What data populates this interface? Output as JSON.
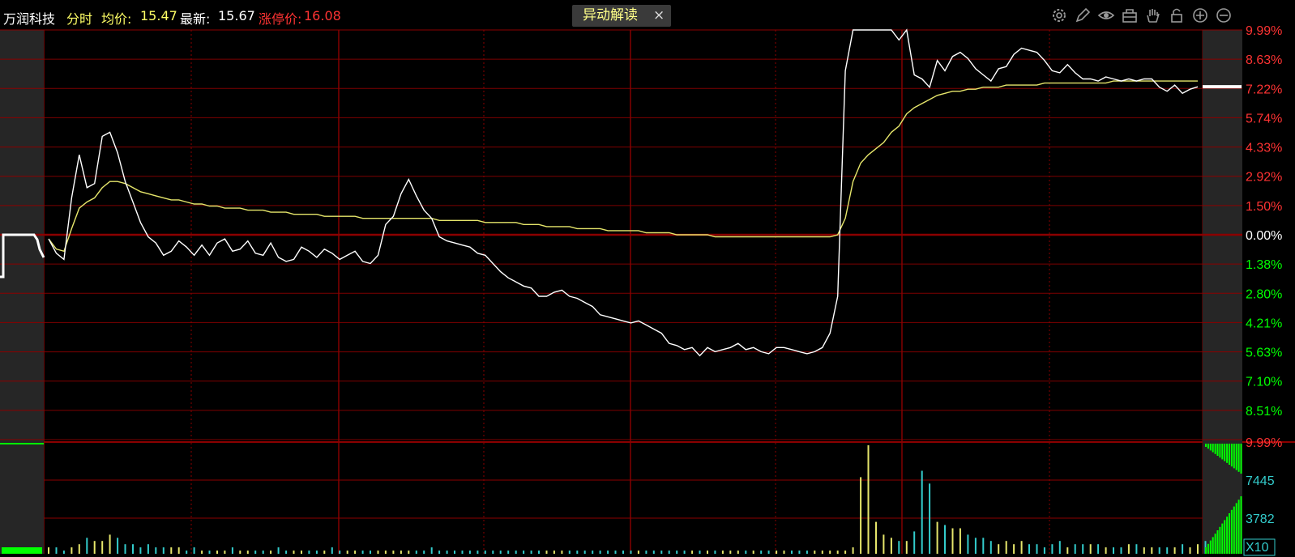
{
  "header": {
    "stock_name": "万润科技",
    "mode": "分时",
    "avg_label": "均价:",
    "avg_value": "15.47",
    "last_label": "最新:",
    "last_value": "15.67",
    "limit_label": "涨停价:",
    "limit_value": "16.08"
  },
  "alert_button": {
    "label": "异动解读",
    "close": "×"
  },
  "toolbar": [
    "settings-icon",
    "pen-icon",
    "eye-icon",
    "basket-icon",
    "hand-icon",
    "lock-icon",
    "zoom-in-icon",
    "zoom-out-icon"
  ],
  "colors": {
    "background": "#000000",
    "grid": "#8b0000",
    "price": "#ffffff",
    "avg": "#e6e66b",
    "up": "#ff3333",
    "down": "#00ff00",
    "volume_up": "#e6e66b",
    "volume_down": "#33cccc"
  },
  "chart_data": {
    "type": "line",
    "price_axis_labels": {
      "up": [
        "9.99%",
        "8.63%",
        "7.22%",
        "5.74%",
        "4.33%",
        "2.92%",
        "1.50%"
      ],
      "zero": "0.00%",
      "down": [
        "1.38%",
        "2.80%",
        "4.21%",
        "5.63%",
        "7.10%",
        "8.51%"
      ]
    },
    "volume_axis_labels": [
      "9.99%",
      "7445",
      "3782",
      "X10"
    ],
    "ylim_pct": [
      -9.99,
      9.99
    ],
    "last_change_pct": 7.22,
    "series": [
      {
        "role": "price",
        "values": [
          -0.2,
          -0.9,
          -1.2,
          1.8,
          3.9,
          2.3,
          2.5,
          4.8,
          5.0,
          4.0,
          2.6,
          1.6,
          0.6,
          -0.1,
          -0.4,
          -1.0,
          -0.8,
          -0.3,
          -0.6,
          -1.0,
          -0.5,
          -1.0,
          -0.4,
          -0.2,
          -0.8,
          -0.7,
          -0.3,
          -0.9,
          -1.0,
          -0.4,
          -1.1,
          -1.3,
          -1.2,
          -0.6,
          -0.8,
          -1.1,
          -0.7,
          -0.9,
          -1.2,
          -1.0,
          -0.8,
          -1.3,
          -1.4,
          -1.0,
          0.5,
          0.9,
          2.0,
          2.7,
          1.9,
          1.2,
          0.8,
          -0.1,
          -0.3,
          -0.4,
          -0.5,
          -0.6,
          -0.9,
          -1.0,
          -1.4,
          -1.8,
          -2.1,
          -2.3,
          -2.5,
          -2.6,
          -3.0,
          -3.0,
          -2.8,
          -2.7,
          -3.0,
          -3.1,
          -3.3,
          -3.5,
          -3.9,
          -4.0,
          -4.1,
          -4.2,
          -4.3,
          -4.2,
          -4.4,
          -4.6,
          -4.8,
          -5.3,
          -5.4,
          -5.6,
          -5.5,
          -5.9,
          -5.5,
          -5.7,
          -5.6,
          -5.5,
          -5.3,
          -5.6,
          -5.5,
          -5.7,
          -5.8,
          -5.5,
          -5.5,
          -5.6,
          -5.7,
          -5.8,
          -5.7,
          -5.5,
          -4.8,
          -3.0,
          8.0,
          9.99,
          9.99,
          9.99,
          9.99,
          9.99,
          9.99,
          9.5,
          9.99,
          7.8,
          7.6,
          7.2,
          8.5,
          8.0,
          8.7,
          8.9,
          8.6,
          8.1,
          7.8,
          7.5,
          8.1,
          8.2,
          8.8,
          9.1,
          9.0,
          8.9,
          8.5,
          8.0,
          7.9,
          8.3,
          7.9,
          7.6,
          7.6,
          7.5,
          7.7,
          7.6,
          7.5,
          7.6,
          7.5,
          7.6,
          7.6,
          7.2,
          7.0,
          7.3,
          6.9,
          7.1,
          7.22
        ]
      },
      {
        "role": "average",
        "values": [
          -0.2,
          -0.7,
          -0.8,
          0.3,
          1.3,
          1.6,
          1.8,
          2.3,
          2.6,
          2.6,
          2.5,
          2.3,
          2.1,
          2.0,
          1.9,
          1.8,
          1.7,
          1.7,
          1.6,
          1.5,
          1.5,
          1.4,
          1.4,
          1.3,
          1.3,
          1.3,
          1.2,
          1.2,
          1.2,
          1.1,
          1.1,
          1.1,
          1.0,
          1.0,
          1.0,
          1.0,
          0.9,
          0.9,
          0.9,
          0.9,
          0.9,
          0.8,
          0.8,
          0.8,
          0.8,
          0.8,
          0.8,
          0.8,
          0.8,
          0.8,
          0.8,
          0.7,
          0.7,
          0.7,
          0.7,
          0.7,
          0.7,
          0.6,
          0.6,
          0.6,
          0.6,
          0.6,
          0.5,
          0.5,
          0.5,
          0.4,
          0.4,
          0.4,
          0.4,
          0.3,
          0.3,
          0.3,
          0.3,
          0.2,
          0.2,
          0.2,
          0.2,
          0.2,
          0.1,
          0.1,
          0.1,
          0.1,
          0.0,
          0.0,
          0.0,
          0.0,
          0.0,
          -0.1,
          -0.1,
          -0.1,
          -0.1,
          -0.1,
          -0.1,
          -0.1,
          -0.1,
          -0.1,
          -0.1,
          -0.1,
          -0.1,
          -0.1,
          -0.1,
          -0.1,
          -0.1,
          0.0,
          0.8,
          2.6,
          3.5,
          3.9,
          4.2,
          4.5,
          5.0,
          5.3,
          5.9,
          6.2,
          6.4,
          6.6,
          6.8,
          6.9,
          7.0,
          7.0,
          7.1,
          7.1,
          7.2,
          7.2,
          7.2,
          7.3,
          7.3,
          7.3,
          7.3,
          7.3,
          7.4,
          7.4,
          7.4,
          7.4,
          7.4,
          7.4,
          7.4,
          7.4,
          7.4,
          7.5,
          7.5,
          7.5,
          7.5,
          7.5,
          7.5,
          7.5,
          7.5,
          7.5,
          7.5,
          7.5,
          7.5
        ]
      },
      {
        "role": "volume",
        "values": [
          2,
          2,
          1,
          2,
          3,
          5,
          4,
          4,
          6,
          5,
          3,
          3,
          2,
          3,
          2,
          2,
          2,
          2,
          1,
          2,
          1,
          1,
          1,
          1,
          2,
          1,
          1,
          1,
          1,
          1,
          2,
          1,
          1,
          1,
          1,
          1,
          1,
          2,
          1,
          1,
          1,
          1,
          1,
          1,
          1,
          1,
          1,
          1,
          1,
          1,
          2,
          1,
          1,
          1,
          1,
          1,
          1,
          1,
          1,
          1,
          1,
          1,
          1,
          1,
          1,
          1,
          1,
          1,
          1,
          1,
          1,
          1,
          1,
          1,
          1,
          1,
          1,
          1,
          1,
          1,
          1,
          1,
          1,
          1,
          1,
          1,
          1,
          1,
          1,
          1,
          1,
          1,
          1,
          1,
          1,
          1,
          1,
          1,
          1,
          1,
          1,
          1,
          1,
          1,
          1,
          2,
          24,
          34,
          10,
          6,
          5,
          4,
          4,
          7,
          26,
          22,
          10,
          9,
          8,
          8,
          6,
          5,
          5,
          4,
          3,
          4,
          3,
          4,
          3,
          3,
          2,
          3,
          4,
          2,
          3,
          3,
          3,
          3,
          2,
          2,
          2,
          3,
          3,
          2,
          2,
          2,
          2,
          2,
          3,
          2,
          3,
          4
        ]
      }
    ]
  }
}
